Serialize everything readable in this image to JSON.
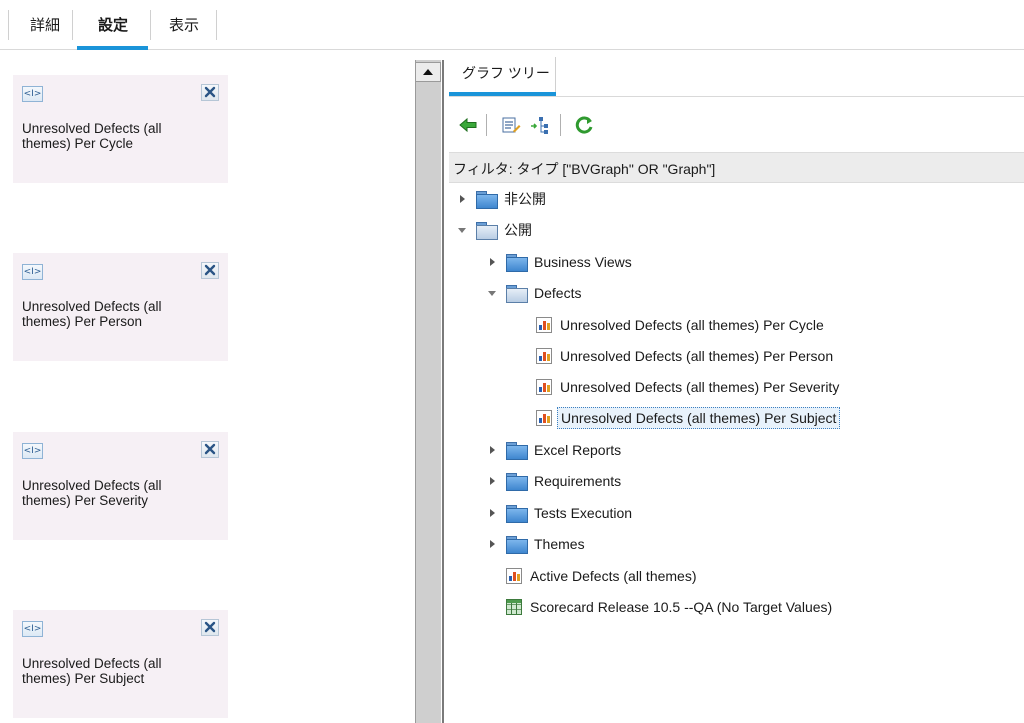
{
  "tabs": [
    {
      "label": "詳細"
    },
    {
      "label": "設定"
    },
    {
      "label": "表示"
    }
  ],
  "cards": [
    {
      "code_label": "<I>",
      "title": "Unresolved Defects (all themes) Per Cycle"
    },
    {
      "code_label": "<I>",
      "title": "Unresolved Defects (all themes) Per Person"
    },
    {
      "code_label": "<I>",
      "title": "Unresolved Defects (all themes) Per Severity"
    },
    {
      "code_label": "<I>",
      "title": "Unresolved Defects (all themes) Per Subject"
    }
  ],
  "graph_tree_tab": {
    "label": "グラフ ツリー"
  },
  "toolbar": {
    "icons": [
      "back-arrow-icon",
      "edit-list-icon",
      "tree-structure-icon",
      "refresh-icon"
    ]
  },
  "filter": {
    "text": "フィルタ: タイプ [\"BVGraph\" OR \"Graph\"]"
  },
  "tree": {
    "private_folder": "非公開",
    "public_folder": "公開",
    "business_views": "Business Views",
    "defects": "Defects",
    "defect_items": [
      "Unresolved Defects (all themes) Per Cycle",
      "Unresolved Defects (all themes) Per Person",
      "Unresolved Defects (all themes) Per Severity",
      "Unresolved Defects (all themes) Per Subject"
    ],
    "excel_reports": "Excel Reports",
    "requirements": "Requirements",
    "tests_execution": "Tests Execution",
    "themes": "Themes",
    "active_defects": "Active Defects (all themes)",
    "scorecard": "Scorecard Release 10.5 --QA (No Target Values)"
  },
  "colors": {
    "accent": "#1a94d9",
    "card_bg": "#f6f0f5",
    "filter_bg": "#ececec"
  }
}
